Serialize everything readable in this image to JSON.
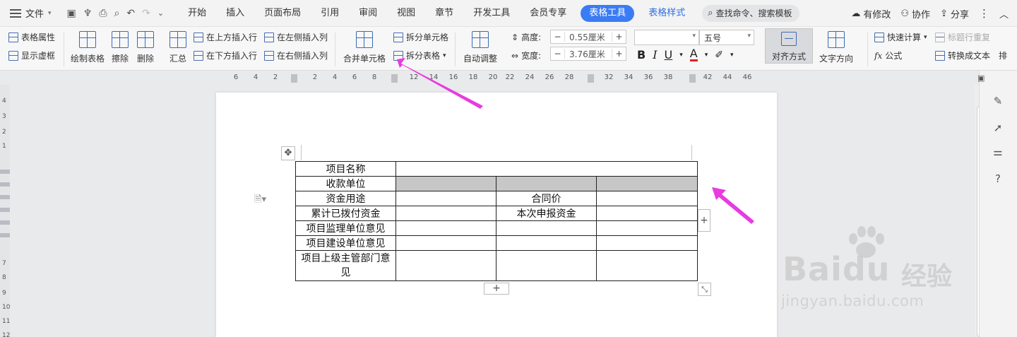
{
  "menubar": {
    "file_label": "文件",
    "tabs": [
      {
        "label": "开始",
        "style": "normal"
      },
      {
        "label": "插入",
        "style": "normal"
      },
      {
        "label": "页面布局",
        "style": "normal"
      },
      {
        "label": "引用",
        "style": "normal"
      },
      {
        "label": "审阅",
        "style": "normal"
      },
      {
        "label": "视图",
        "style": "normal"
      },
      {
        "label": "章节",
        "style": "normal"
      },
      {
        "label": "开发工具",
        "style": "normal"
      },
      {
        "label": "会员专享",
        "style": "normal"
      },
      {
        "label": "表格工具",
        "style": "active"
      },
      {
        "label": "表格样式",
        "style": "blue"
      }
    ],
    "search_placeholder": "查找命令、搜索模板",
    "right": {
      "modified": "有修改",
      "collaborate": "协作",
      "share": "分享"
    }
  },
  "ribbon": {
    "table_props": "表格属性",
    "show_gridlines": "显示虚框",
    "draw_table": "绘制表格",
    "erase": "擦除",
    "delete": "删除",
    "summary": "汇总",
    "insert_above": "在上方插入行",
    "insert_below": "在下方插入行",
    "insert_left": "在左侧插入列",
    "insert_right": "在右侧插入列",
    "merge_cells": "合并单元格",
    "split_cells": "拆分单元格",
    "split_table": "拆分表格",
    "auto_adjust": "自动调整",
    "height_label": "高度:",
    "height_value": "0.55厘米",
    "width_label": "宽度:",
    "width_value": "3.76厘米",
    "font_name": "",
    "font_size": "五号",
    "align": "对齐方式",
    "text_direction": "文字方向",
    "quick_calc": "快速计算",
    "title_repeat": "标题行重复",
    "formula": "公式",
    "to_text": "转换成文本",
    "more": "排"
  },
  "ruler": {
    "ticks": [
      "6",
      "4",
      "2",
      "2",
      "4",
      "6",
      "8",
      "12",
      "14",
      "16",
      "18",
      "20",
      "22",
      "24",
      "26",
      "28",
      "32",
      "34",
      "36",
      "38",
      "42",
      "44",
      "46"
    ]
  },
  "vruler": {
    "labels": [
      "4",
      "3",
      "2",
      "1",
      "7",
      "8",
      "9",
      "10",
      "11",
      "12"
    ]
  },
  "table": {
    "rows": [
      [
        "项目名称",
        "",
        "",
        ""
      ],
      [
        "收款单位",
        "",
        "",
        ""
      ],
      [
        "资金用途",
        "",
        "合同价",
        ""
      ],
      [
        "累计已拨付资金",
        "",
        "本次申报资金",
        ""
      ],
      [
        "项目监理单位意见",
        "",
        "",
        ""
      ],
      [
        "项目建设单位意见",
        "",
        "",
        ""
      ],
      [
        "项目上级主管部门意见",
        "",
        "",
        ""
      ]
    ]
  },
  "watermark": {
    "logo": "Baidu",
    "cn": "经验",
    "url": "jingyan.baidu.com"
  },
  "colors": {
    "accent": "#3b7cf4",
    "arrow": "#e83be0",
    "selected_cell": "#c7c7c7"
  }
}
